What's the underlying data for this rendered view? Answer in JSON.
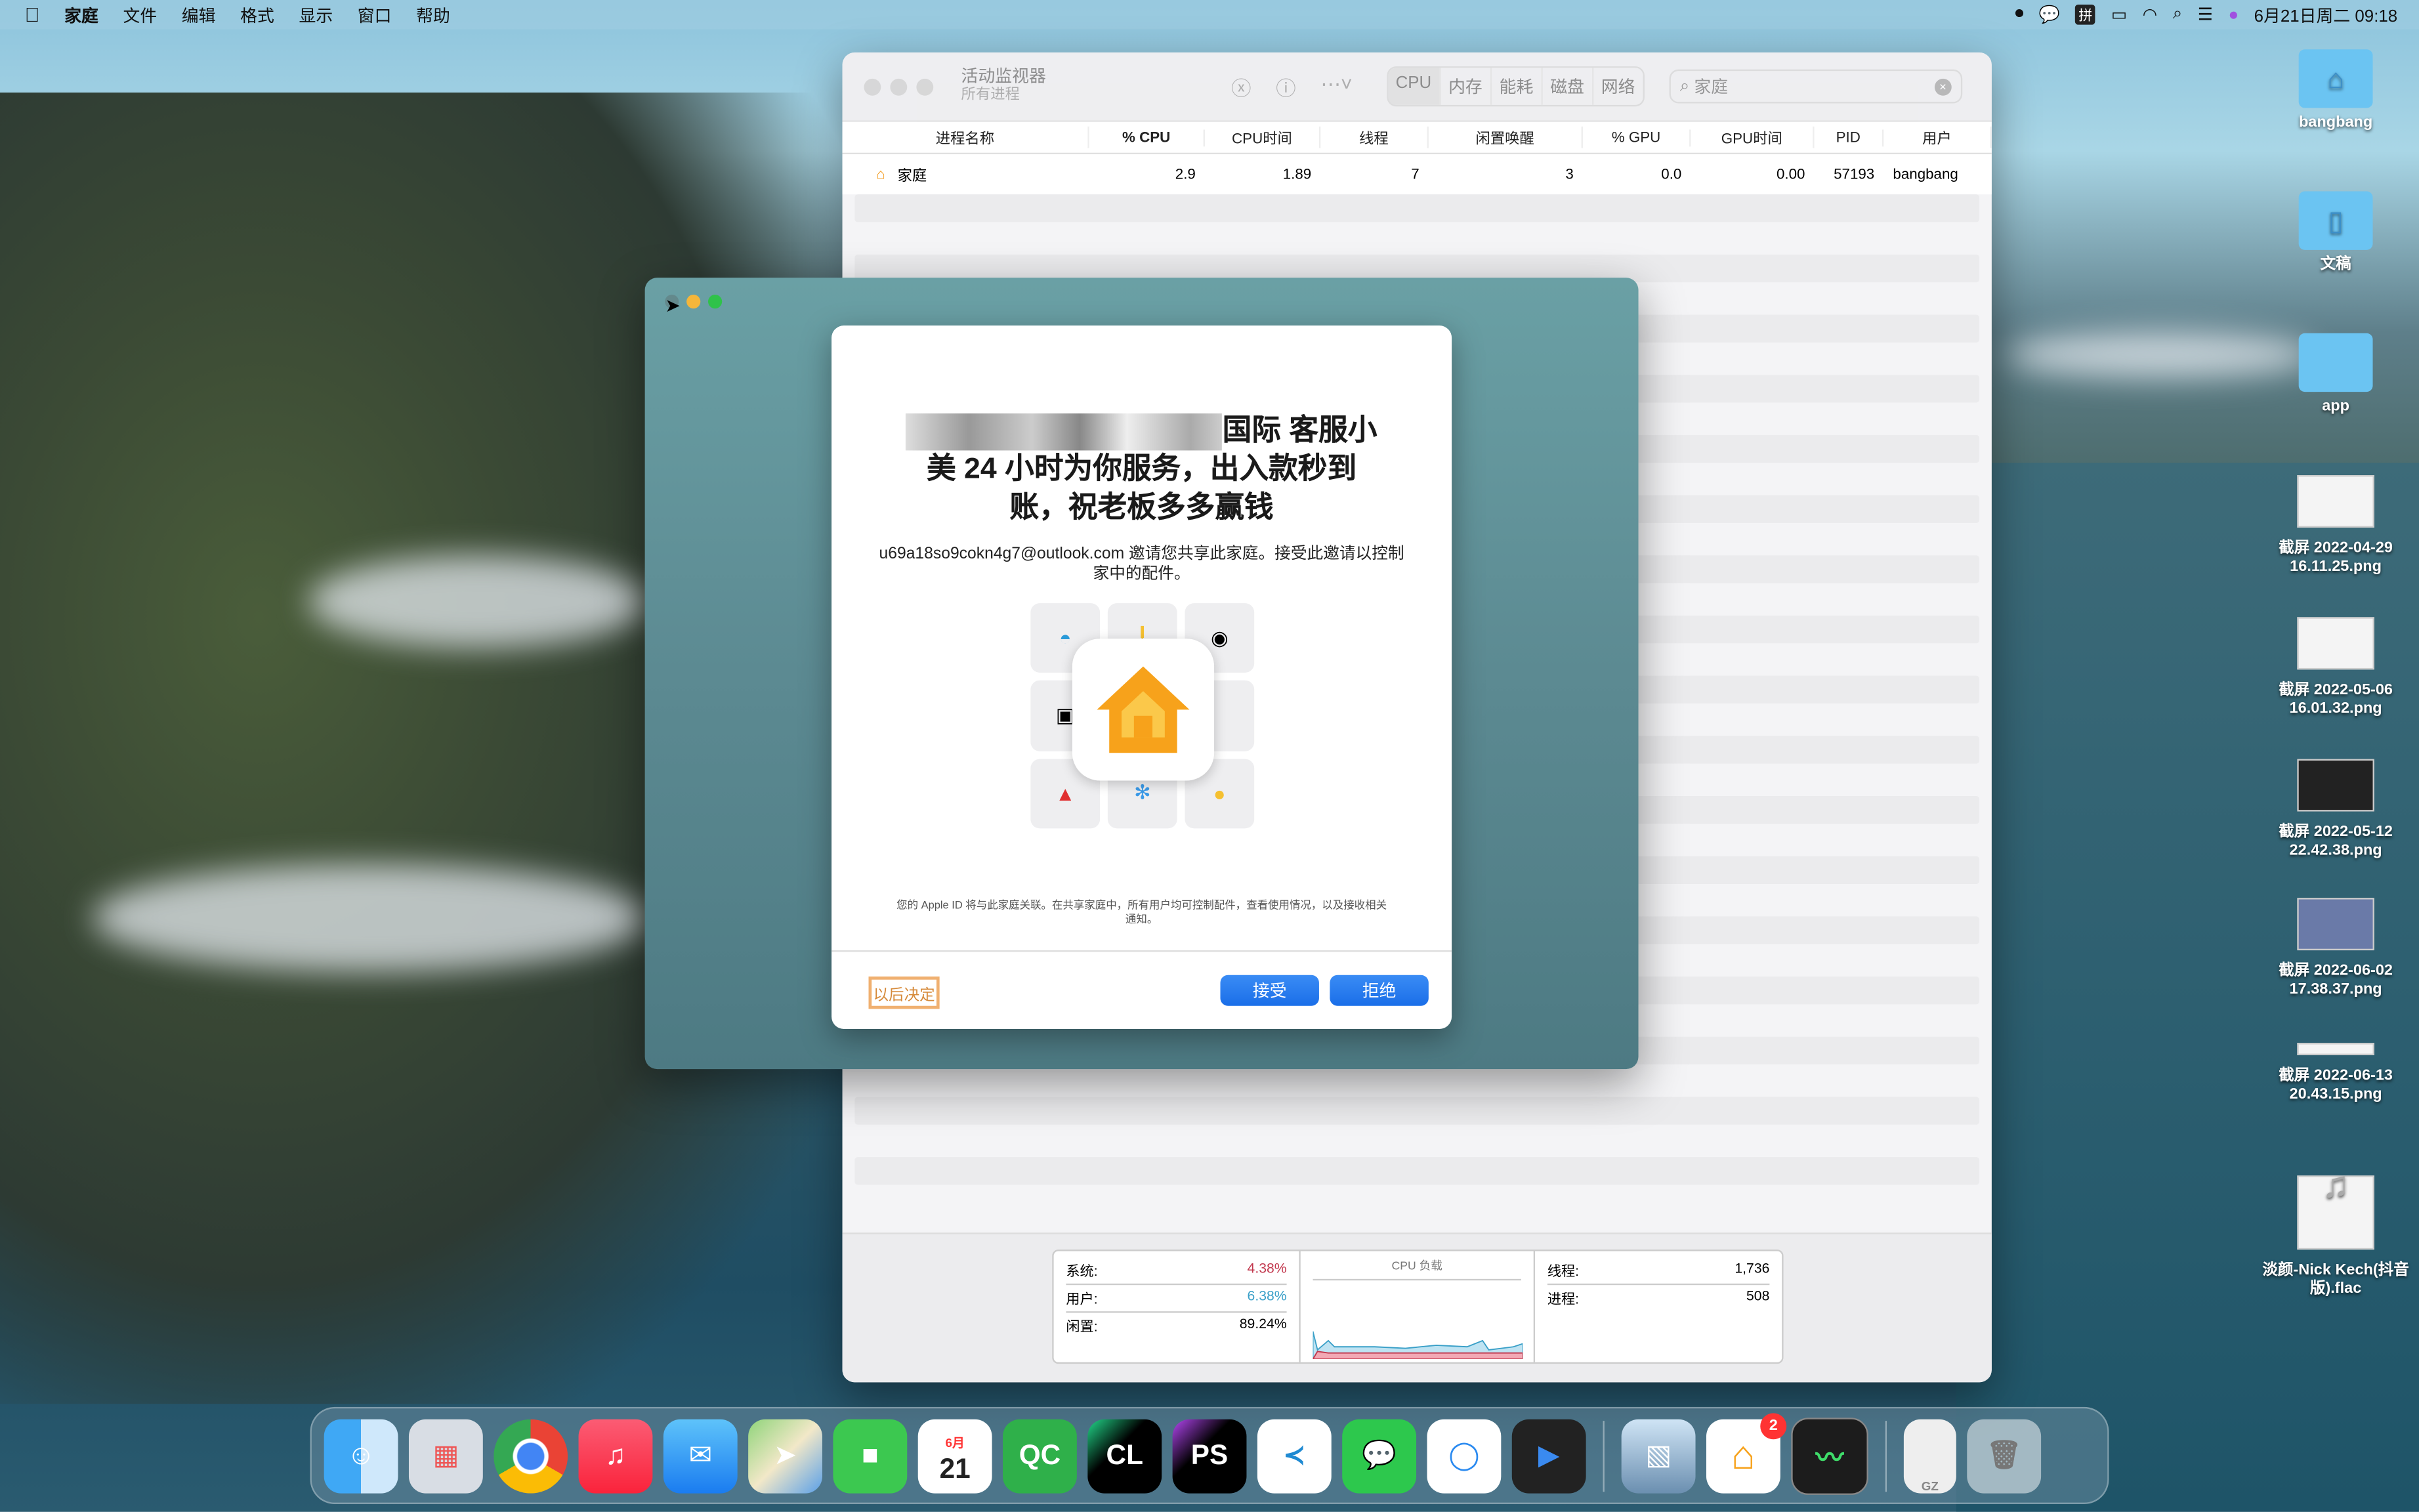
{
  "menubar": {
    "app": "家庭",
    "items": [
      "文件",
      "编辑",
      "格式",
      "显示",
      "窗口",
      "帮助"
    ],
    "clock": "6月21日周二 09:18",
    "status_icons": [
      "record-icon",
      "wechat-icon",
      "pinyin-icon",
      "battery-icon",
      "wifi-icon",
      "search-icon",
      "control-center-icon",
      "siri-icon"
    ],
    "pinyin": "拼"
  },
  "activity_monitor": {
    "title": "活动监视器",
    "subtitle": "所有进程",
    "tabs": [
      "CPU",
      "内存",
      "能耗",
      "磁盘",
      "网络"
    ],
    "active_tab": "CPU",
    "search_value": "家庭",
    "columns": [
      "进程名称",
      "% CPU",
      "CPU时间",
      "线程",
      "闲置唤醒",
      "% GPU",
      "GPU时间",
      "PID",
      "用户"
    ],
    "rows": [
      {
        "name": "家庭",
        "cpu": "2.9",
        "cpu_time": "1.89",
        "threads": "7",
        "idle_wakeups": "3",
        "gpu": "0.0",
        "gpu_time": "0.00",
        "pid": "57193",
        "user": "bangbang"
      }
    ],
    "footer": {
      "system_label": "系统:",
      "system": "4.38%",
      "user_label": "用户:",
      "user": "6.38%",
      "idle_label": "闲置:",
      "idle": "89.24%",
      "chart_title": "CPU 负载",
      "threads_label": "线程:",
      "threads": "1,736",
      "processes_label": "进程:",
      "processes": "508",
      "system_color": "#c2384e",
      "user_color": "#3aa0c8"
    }
  },
  "home_dialog": {
    "title_visible": "国际 客服小美 24 小时为你服务，出入款秒到账，祝老板多多赢钱",
    "title_line1": "国际 客服小",
    "title_line2": "美 24 小时为你服务，出入款秒到",
    "title_line3": "账，祝老板多多赢钱",
    "invite_text": "u69a18so9cokn4g7@outlook.com 邀请您共享此家庭。接受此邀请以控制家中的配件。",
    "note": "您的 Apple ID 将与此家庭关联。在共享家庭中，所有用户均可控制配件，查看使用情况，以及接收相关通知。",
    "later": "以后决定",
    "accept": "接受",
    "decline": "拒绝",
    "accent": "#1a6ee8"
  },
  "desktop": [
    {
      "label": "bangbang",
      "type": "home-folder"
    },
    {
      "label": "文稿",
      "type": "documents-folder"
    },
    {
      "label": "app",
      "type": "folder"
    },
    {
      "label": "截屏 2022-04-29 16.11.25.png"
    },
    {
      "label": "截屏 2022-05-06 16.01.32.png"
    },
    {
      "label": "截屏 2022-05-12 22.42.38.png"
    },
    {
      "label": "截屏 2022-06-02 17.38.37.png"
    },
    {
      "label": "截屏 2022-06-13 20.43.15.png"
    },
    {
      "label": "淡颜-Nick Kech(抖音版).flac",
      "type": "audio"
    }
  ],
  "dock": {
    "calendar_month": "6月",
    "calendar_day": "21",
    "qc": "QC",
    "cl": "CL",
    "ps": "PS",
    "home_badge": "2",
    "gz": "GZ"
  }
}
